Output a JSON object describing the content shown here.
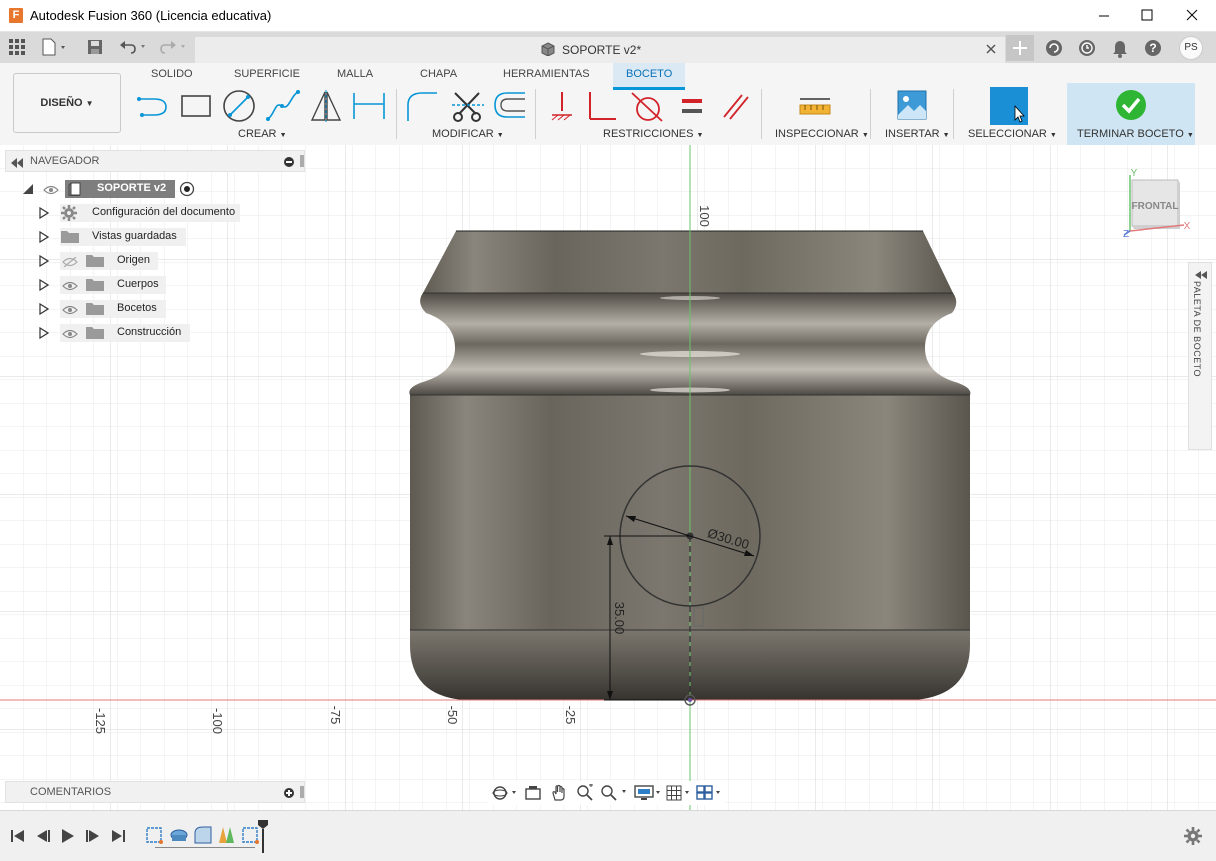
{
  "window": {
    "title": "Autodesk Fusion 360 (Licencia educativa)",
    "logo_letter": "F"
  },
  "document": {
    "tab_title": "SOPORTE v2*",
    "user_initials": "PS"
  },
  "ribbon": {
    "workspace": "DISEÑO",
    "tabs": [
      "SOLIDO",
      "SUPERFICIE",
      "MALLA",
      "CHAPA",
      "HERRAMIENTAS",
      "BOCETO"
    ],
    "active_tab": "BOCETO",
    "groups": [
      "CREAR",
      "MODIFICAR",
      "RESTRICCIONES",
      "INSPECCIONAR",
      "INSERTAR",
      "SELECCIONAR",
      "TERMINAR BOCETO"
    ]
  },
  "browser": {
    "header": "NAVEGADOR",
    "root": "SOPORTE v2",
    "items": [
      {
        "label": "Configuración del documento",
        "icon": "gear-icon"
      },
      {
        "label": "Vistas guardadas",
        "icon": "folder-icon"
      },
      {
        "label": "Origen",
        "icon": "folder-icon",
        "hidden": true
      },
      {
        "label": "Cuerpos",
        "icon": "folder-icon"
      },
      {
        "label": "Bocetos",
        "icon": "folder-icon"
      },
      {
        "label": "Construcción",
        "icon": "folder-icon"
      }
    ]
  },
  "comments": {
    "label": "COMENTARIOS"
  },
  "sketch_palette": {
    "label": "PALETA DE BOCETO"
  },
  "viewcube": {
    "face": "FRONTAL",
    "axis_y": "Y",
    "axis_x": "X",
    "axis_z": "Z"
  },
  "viewport": {
    "ruler_x": [
      "-125",
      "-100",
      "-75",
      "-50",
      "-25"
    ],
    "ruler_y": "100",
    "dimension_diameter": "Ø30.00",
    "dimension_height": "35.00"
  },
  "colors": {
    "accent": "#0696d7",
    "active_tab_bg": "#dbe9f5",
    "finish_green": "#2fb534",
    "model_dark": "#5f5a52"
  }
}
